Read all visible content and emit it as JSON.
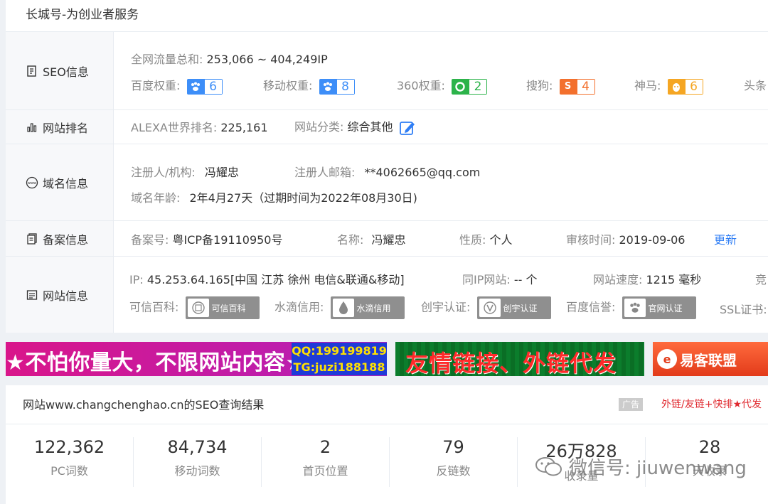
{
  "header": {
    "title": "长城号-为创业者服务"
  },
  "seo": {
    "head": "SEO信息",
    "traffic_label": "全网流量总和:",
    "traffic_value": "253,066 ~ 404,249IP",
    "weights": [
      {
        "label": "百度权重:",
        "value": "6",
        "icon": "paw-icon",
        "color": "#3d8ef8"
      },
      {
        "label": "移动权重:",
        "value": "8",
        "icon": "paw-icon",
        "color": "#3d8ef8"
      },
      {
        "label": "360权重:",
        "value": "2",
        "icon": "360-icon",
        "color": "#2cb34a"
      },
      {
        "label": "搜狗:",
        "value": "4",
        "icon": "sogou-icon",
        "color": "#f3702d"
      },
      {
        "label": "神马:",
        "value": "6",
        "icon": "shenma-icon",
        "color": "#f5a623"
      },
      {
        "label": "头条"
      }
    ]
  },
  "ranking": {
    "head": "网站排名",
    "alexa_label": "ALEXA世界排名:",
    "alexa_value": "225,161",
    "category_label": "网站分类:",
    "category_value": "综合其他"
  },
  "domain": {
    "head": "域名信息",
    "registrant_label": "注册人/机构:",
    "registrant_value": "冯耀忠",
    "email_label": "注册人邮箱:",
    "email_value": "**4062665@qq.com",
    "age_label": "域名年龄:",
    "age_value": "2年4月27天（过期时间为2022年08月30日)"
  },
  "icp": {
    "head": "备案信息",
    "number_label": "备案号:",
    "number_value": "粤ICP备19110950号",
    "name_label": "名称:",
    "name_value": "冯耀忠",
    "nature_label": "性质:",
    "nature_value": "个人",
    "audit_label": "审核时间:",
    "audit_value": "2019-09-06",
    "update_link": "更新"
  },
  "siteinfo": {
    "head": "网站信息",
    "ip_label": "IP:",
    "ip_value": "45.253.64.165[中国 江苏 徐州 电信&联通&移动]",
    "sameip_label": "同IP网站:",
    "sameip_value": "-- 个",
    "speed_label": "网站速度:",
    "speed_value": "1215 毫秒",
    "trail": "竞",
    "certs": [
      {
        "label": "可信百科:",
        "badge": "可信百科",
        "icon": "kexin-icon"
      },
      {
        "label": "水滴信用:",
        "badge": "水滴信用",
        "icon": "water-drop-icon"
      },
      {
        "label": "创宇认证:",
        "badge": "创宇认证",
        "icon": "chuangyu-icon"
      },
      {
        "label": "百度信誉:",
        "badge": "官网认证",
        "icon": "baidu-paw-icon"
      }
    ],
    "ssl_label": "SSL证书:"
  },
  "ads": {
    "ad1_text": "★不怕你量大，不限网站内容★",
    "ad1_qq": "QQ:199199819",
    "ad1_tg": "TG:juzi188188",
    "ad2_text": "友情链接、外链代发",
    "ad3_text": "易客联盟"
  },
  "results": {
    "title": "网站www.changchenghao.cn的SEO查询结果",
    "ad_tag": "广告",
    "ad_text": "外链/友链+快排★代发",
    "stats": [
      {
        "value": "122,362",
        "label": "PC词数"
      },
      {
        "value": "84,734",
        "label": "移动词数"
      },
      {
        "value": "2",
        "label": "首页位置"
      },
      {
        "value": "79",
        "label": "反链数"
      },
      {
        "value": "26万828",
        "label": "收录量"
      },
      {
        "value": "28",
        "label": "天收录"
      }
    ]
  },
  "watermark": {
    "text": "微信号: jiuwenwang"
  }
}
